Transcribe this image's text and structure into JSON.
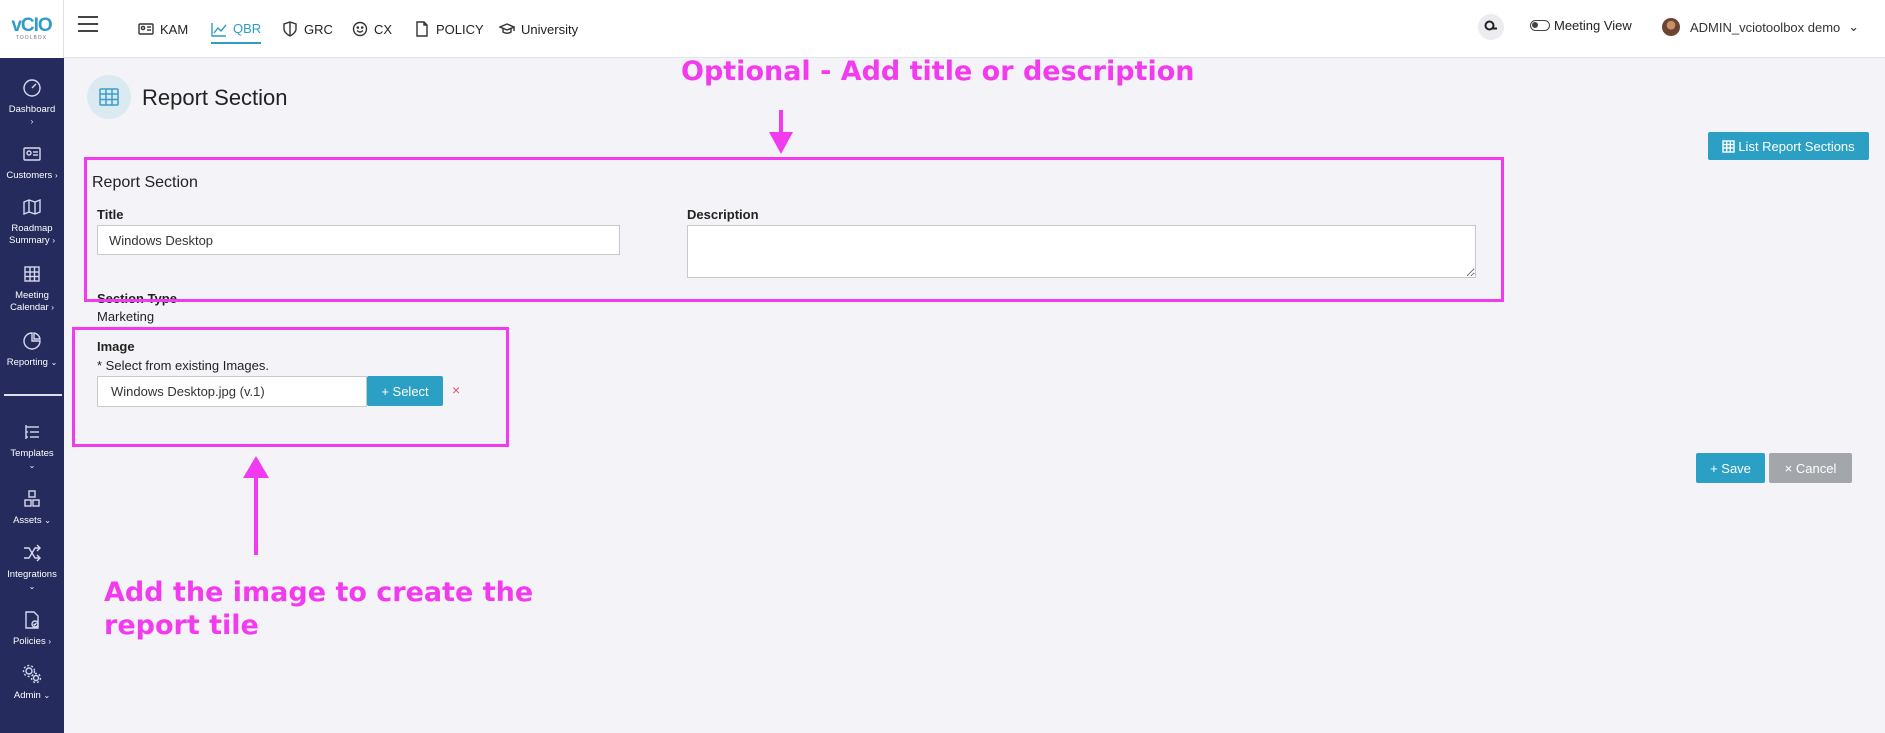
{
  "logo": {
    "main": "vCIO",
    "sub": "TOOLBOX"
  },
  "sidebar": {
    "items": [
      {
        "label": "Dashboard",
        "chevron": "›",
        "icon": "dashboard-icon"
      },
      {
        "label": "Customers",
        "chevron": "›",
        "icon": "customers-icon"
      },
      {
        "label": "Roadmap Summary",
        "chevron": "›",
        "icon": "map-icon"
      },
      {
        "label": "Meeting Calendar",
        "chevron": "›",
        "icon": "calendar-icon"
      },
      {
        "label": "Reporting",
        "chevron": "⌄",
        "icon": "pie-chart-icon"
      },
      {
        "label": "Templates",
        "chevron": "⌄",
        "icon": "templates-icon"
      },
      {
        "label": "Assets",
        "chevron": "⌄",
        "icon": "assets-icon"
      },
      {
        "label": "Integrations",
        "chevron": "⌄",
        "icon": "integrations-icon"
      },
      {
        "label": "Policies",
        "chevron": "›",
        "icon": "policies-icon"
      },
      {
        "label": "Admin",
        "chevron": "⌄",
        "icon": "admin-icon"
      }
    ]
  },
  "topnav": {
    "items": [
      {
        "label": "KAM",
        "icon": "id-card-icon",
        "active": false
      },
      {
        "label": "QBR",
        "icon": "line-chart-icon",
        "active": true
      },
      {
        "label": "GRC",
        "icon": "shield-icon",
        "active": false
      },
      {
        "label": "CX",
        "icon": "smile-icon",
        "active": false
      },
      {
        "label": "POLICY",
        "icon": "document-icon",
        "active": false
      },
      {
        "label": "University",
        "icon": "graduation-cap-icon",
        "active": false
      }
    ],
    "meeting_view": "Meeting View",
    "user": "ADMIN_vciotoolbox demo",
    "user_chevron": "⌄"
  },
  "page": {
    "title": "Report Section",
    "list_button": "List Report Sections"
  },
  "form": {
    "heading": "Report Section",
    "title_label": "Title",
    "title_value": "Windows Desktop",
    "description_label": "Description",
    "description_value": "",
    "section_type_label": "Section Type",
    "section_type_value": "Marketing",
    "image_label": "Image",
    "image_hint": "* Select from existing Images.",
    "image_value": "Windows Desktop.jpg (v.1)",
    "select_button": "+ Select",
    "clear_symbol": "×",
    "save_button": "+ Save",
    "cancel_button": "× Cancel"
  },
  "annotations": {
    "top_text": "Optional - Add title or description",
    "bottom_text_line1": "Add the image to create the",
    "bottom_text_line2": "report tile",
    "color": "#f23bef"
  },
  "colors": {
    "sidebar": "#252b5d",
    "accent": "#2ba0c4",
    "cancel": "#a3a6ab"
  }
}
